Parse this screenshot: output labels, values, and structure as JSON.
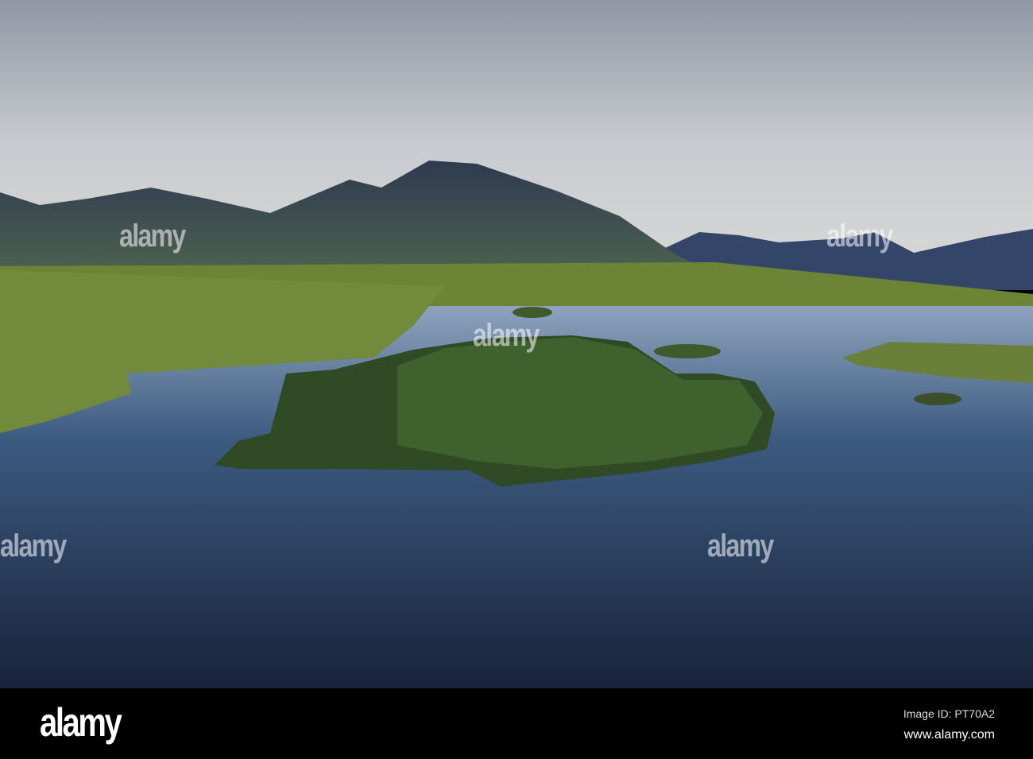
{
  "watermark": "alamy",
  "footer": {
    "logo": "alamy",
    "image_id": "Image ID: PT70A2",
    "website": "www.alamy.com"
  },
  "colors": {
    "sky": "#c9ccd1",
    "mountain": "#3a4a63",
    "grass": "#6f8a3a",
    "water": "#1c2a44",
    "footer": "#000000"
  }
}
